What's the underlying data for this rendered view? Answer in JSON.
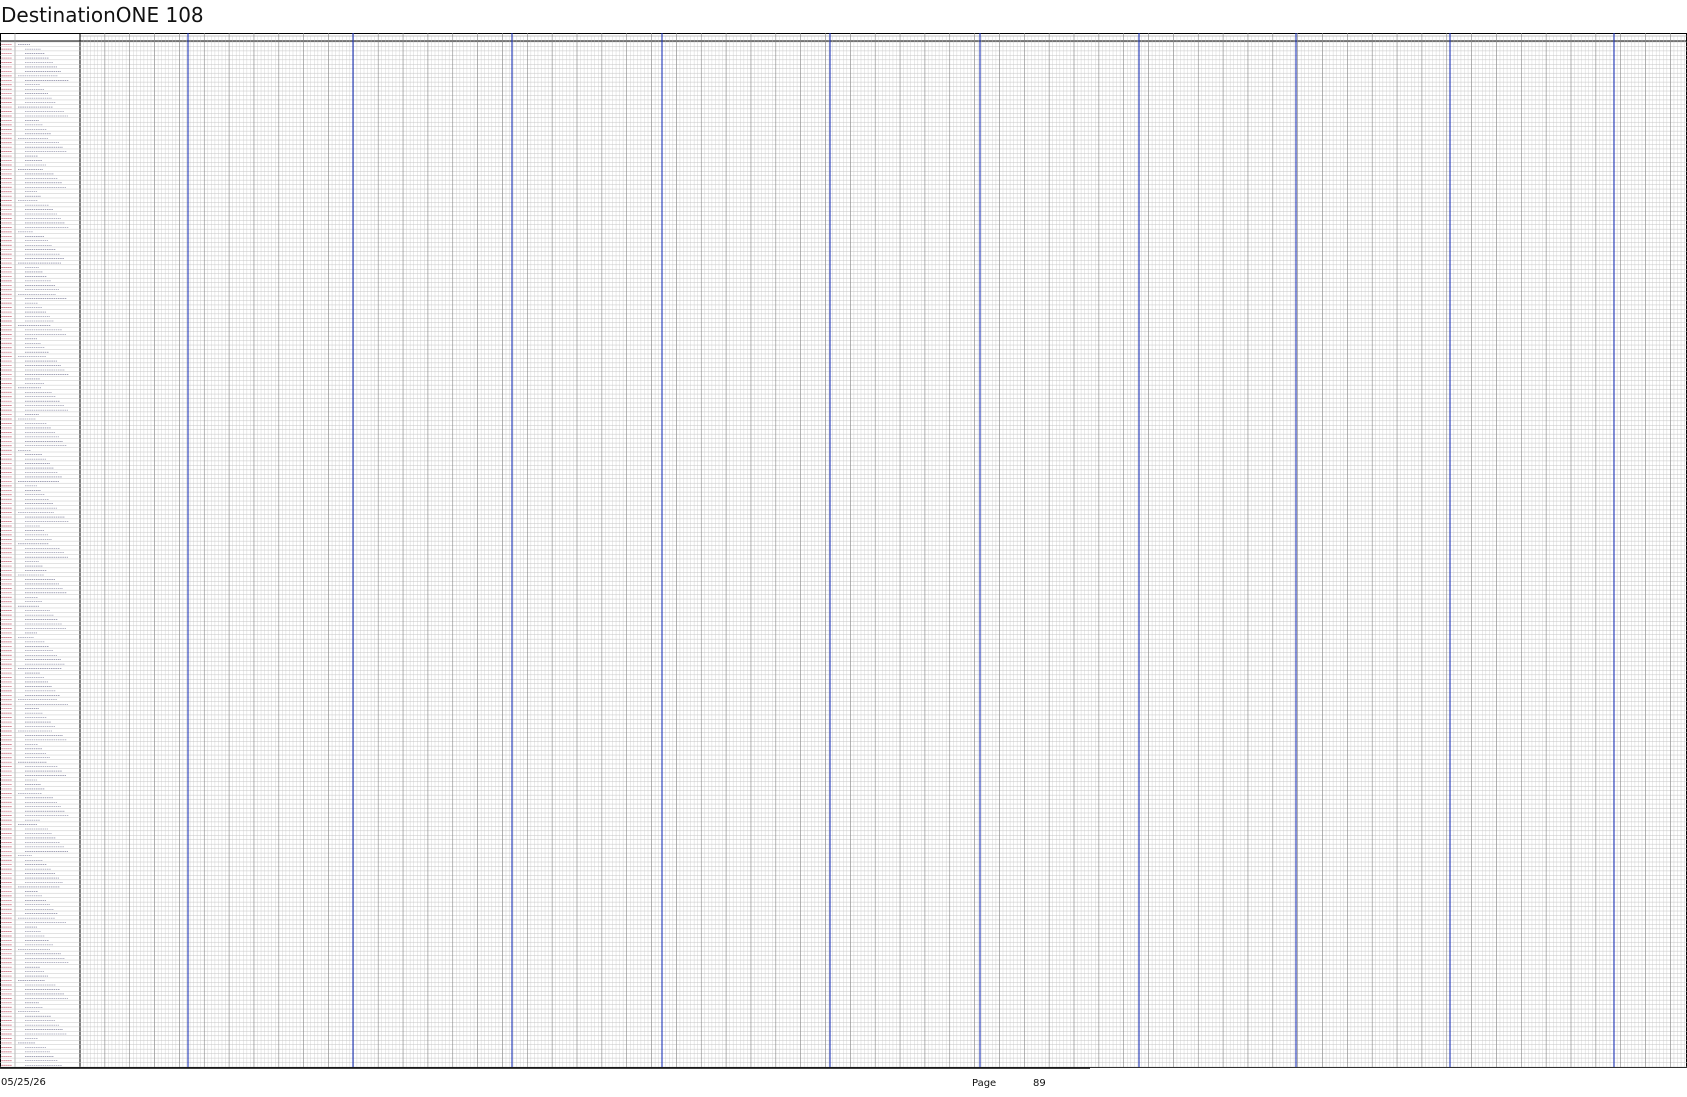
{
  "document": {
    "title": "DestinationONE 108"
  },
  "footer": {
    "date": "05/25/26",
    "page_label": "Page",
    "page_number": "89"
  },
  "colors": {
    "grid_line": "#888888",
    "grid_line_light": "#c4c4c4",
    "section_divider": "#1f36b8",
    "row_code_text": "#b0203a",
    "row_label_text": "#6a6a8a",
    "border": "#000000"
  },
  "grid": {
    "header_code_label": "",
    "header_name_label": "",
    "row_count": 230,
    "section_count": 18
  }
}
